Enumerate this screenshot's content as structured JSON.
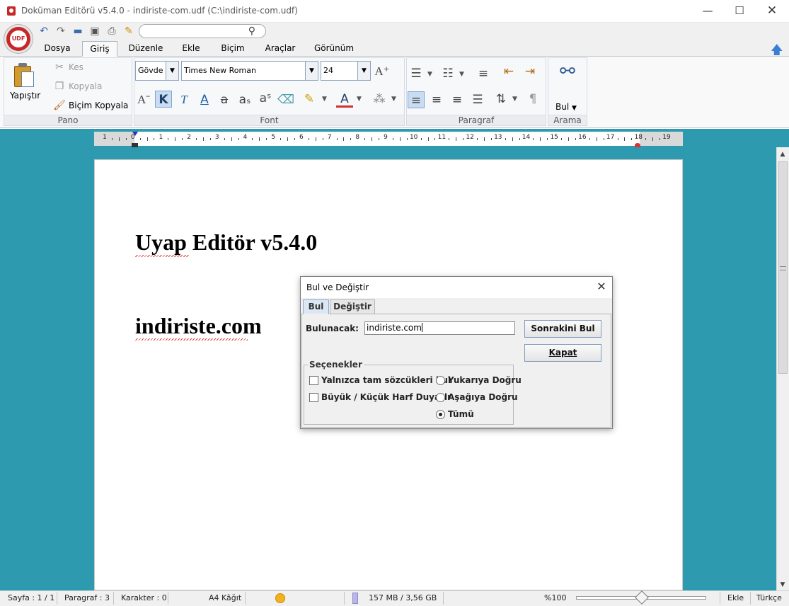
{
  "window": {
    "title": "Doküman Editörü v5.4.0 - indiriste-com.udf (C:\\indiriste-com.udf)",
    "minimize": "—",
    "maximize": "☐",
    "close": "✕"
  },
  "logo": {
    "text": "UDF"
  },
  "quick_access": {
    "search_placeholder": ""
  },
  "tabs": [
    {
      "label": "Dosya"
    },
    {
      "label": "Giriş"
    },
    {
      "label": "Düzenle"
    },
    {
      "label": "Ekle"
    },
    {
      "label": "Biçim"
    },
    {
      "label": "Araçlar"
    },
    {
      "label": "Görünüm"
    }
  ],
  "ribbon": {
    "pano": {
      "label": "Pano",
      "paste": "Yapıştır",
      "cut": "Kes",
      "copy": "Kopyala",
      "format_painter": "Biçim Kopyala"
    },
    "font": {
      "label": "Font",
      "style": "Gövde",
      "family": "Times New Roman",
      "size": "24"
    },
    "paragraph": {
      "label": "Paragraf"
    },
    "search": {
      "label": "Arama",
      "find": "Bul"
    }
  },
  "ruler": {
    "numbers": [
      "1",
      "0",
      "1",
      "2",
      "3",
      "4",
      "5",
      "6",
      "7",
      "8",
      "9",
      "10",
      "11",
      "12",
      "13",
      "14",
      "15",
      "16",
      "17",
      "18",
      "19"
    ]
  },
  "document": {
    "line1": "Uyap Editör v5.4.0",
    "line2": "indiriste.com"
  },
  "dialog": {
    "title": "Bul ve Değiştir",
    "tabs": [
      "Bul",
      "Değiştir"
    ],
    "find_label": "Bulunacak:",
    "find_value": "indiriste.com",
    "find_next_btn": "Sonrakini Bul",
    "close_btn": "Kapat",
    "options_legend": "Seçenekler",
    "whole_word": "Yalnızca tam sözcükleri bul",
    "match_case": "Büyük / Küçük Harf Duyarlı",
    "dir_up": "Yukarıya Doğru",
    "dir_down": "Aşağıya Doğru",
    "dir_all": "Tümü"
  },
  "status": {
    "page": "Sayfa : 1 / 1",
    "paragraph": "Paragraf : 3",
    "characters": "Karakter : 0",
    "paper": "A4 Kâğıt",
    "memory": "157 MB / 3,56 GB",
    "zoom": "%100",
    "mode": "Ekle",
    "language": "Türkçe"
  }
}
